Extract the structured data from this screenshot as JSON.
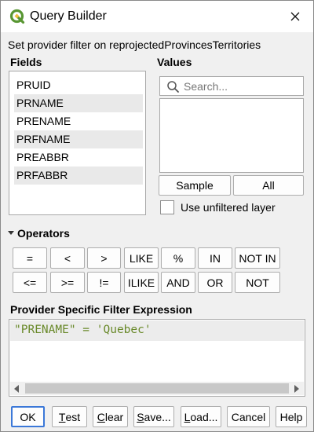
{
  "window": {
    "title": "Query Builder",
    "subtitle": "Set provider filter on reprojectedProvincesTerritories"
  },
  "fields": {
    "heading": "Fields",
    "items": [
      "PRUID",
      "PRNAME",
      "PRENAME",
      "PRFNAME",
      "PREABBR",
      "PRFABBR"
    ]
  },
  "values": {
    "heading": "Values",
    "search_placeholder": "Search...",
    "sample_label": "Sample",
    "all_label": "All",
    "unfiltered_label": "Use unfiltered layer",
    "unfiltered_checked": false
  },
  "operators": {
    "heading": "Operators",
    "row1": [
      "=",
      "<",
      ">",
      "LIKE",
      "%",
      "IN",
      "NOT IN"
    ],
    "row2": [
      "<=",
      ">=",
      "!=",
      "ILIKE",
      "AND",
      "OR",
      "NOT"
    ]
  },
  "expression": {
    "heading": "Provider Specific Filter Expression",
    "text": "\"PRENAME\" = 'Quebec'"
  },
  "buttons": {
    "ok": "OK",
    "test_mnemonic": "T",
    "test_rest": "est",
    "clear_mnemonic": "C",
    "clear_rest": "lear",
    "save_mnemonic": "S",
    "save_rest": "ave...",
    "load_mnemonic": "L",
    "load_rest": "oad...",
    "cancel": "Cancel",
    "help": "Help"
  },
  "colors": {
    "expression_text": "#6a8a2b",
    "default_button_border": "#3b78d8",
    "qgis_green": "#589632",
    "qgis_yellow": "#eebe3b"
  },
  "icons": {
    "app": "qgis-logo-icon",
    "close": "close-icon",
    "search": "search-icon",
    "collapse": "chevron-down-icon"
  }
}
